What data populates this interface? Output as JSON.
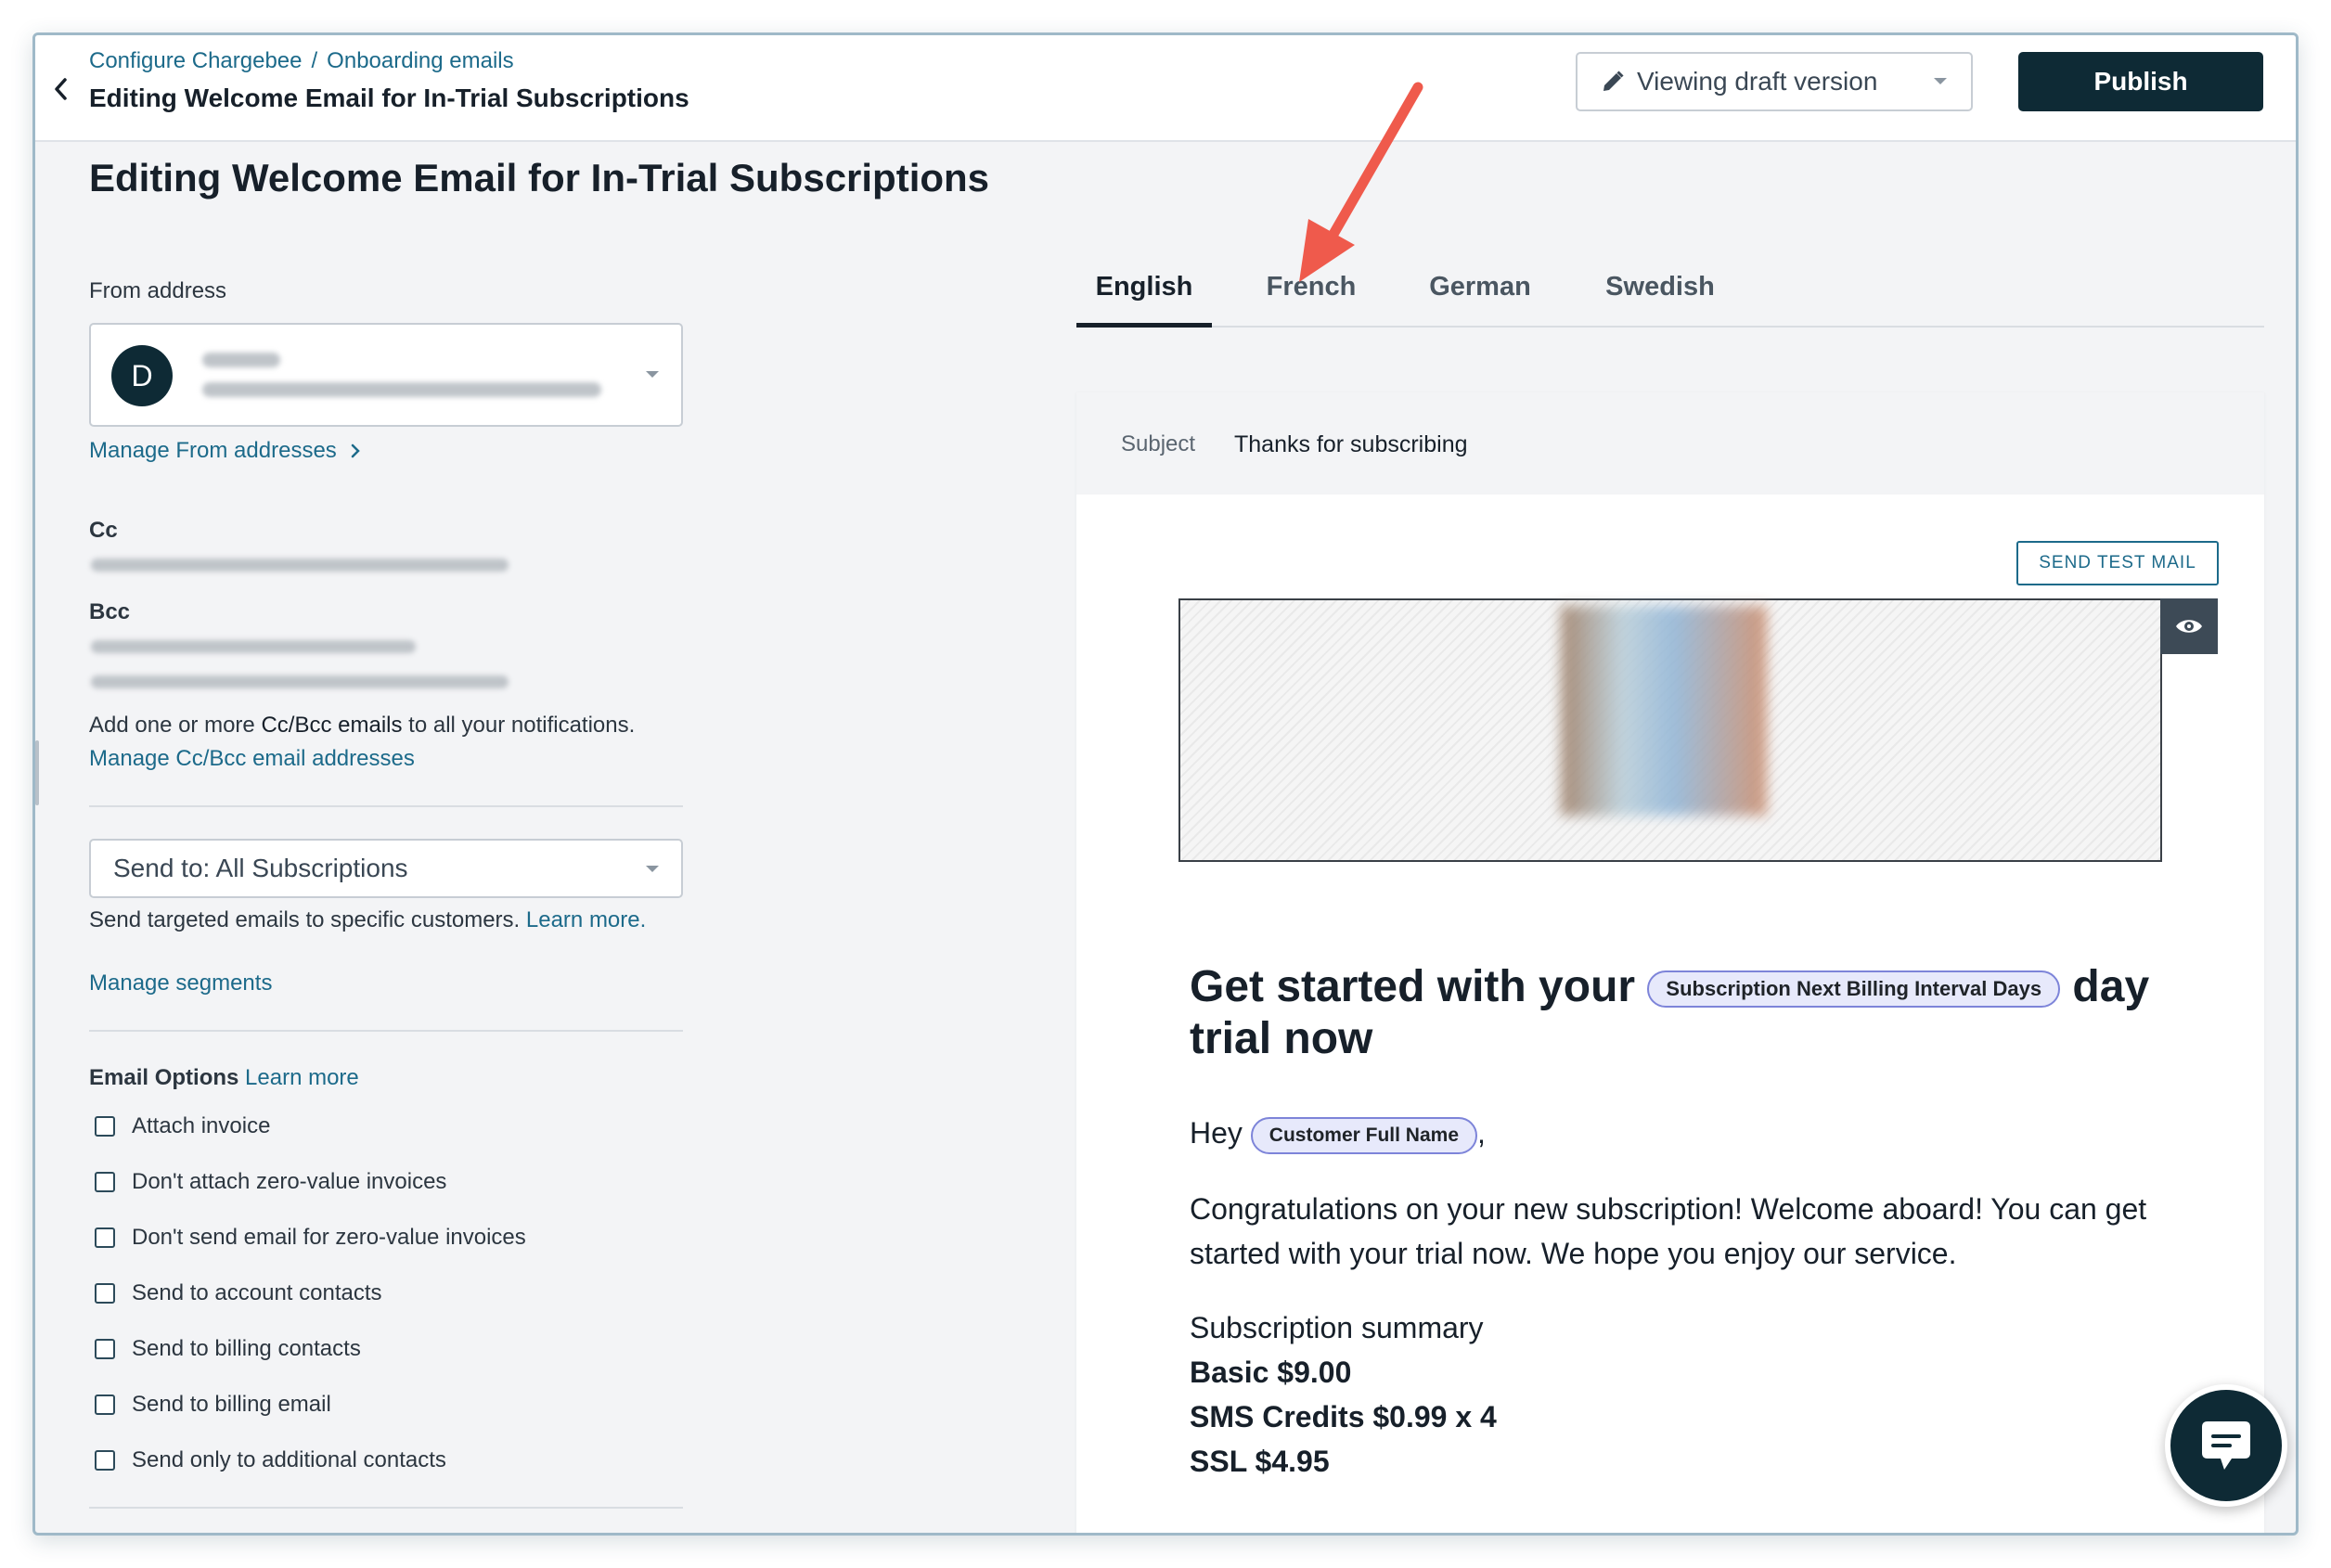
{
  "header": {
    "breadcrumb": [
      "Configure Chargebee",
      "Onboarding emails"
    ],
    "breadcrumb_separator": "/",
    "title": "Editing Welcome Email for In-Trial Subscriptions",
    "version_select": "Viewing draft version",
    "publish_label": "Publish"
  },
  "page": {
    "title": "Editing Welcome Email for In-Trial Subscriptions"
  },
  "left": {
    "from_label": "From address",
    "from_avatar": "D",
    "manage_from_label": "Manage From addresses",
    "cc_label": "Cc",
    "bcc_label": "Bcc",
    "cc_help_prefix": "Add one or more",
    "cc_help_bold": "Cc/Bcc emails",
    "cc_help_suffix": "to all your notifications.",
    "manage_cc_label": "Manage Cc/Bcc email addresses",
    "sendto_value": "Send to: All Subscriptions",
    "sendto_help": "Send targeted emails to specific customers.",
    "sendto_learn": "Learn more.",
    "manage_segments_label": "Manage segments",
    "options_title": "Email Options",
    "options_learn": "Learn more",
    "options": [
      {
        "label": "Attach invoice",
        "checked": false
      },
      {
        "label": "Don't attach zero-value invoices",
        "checked": false
      },
      {
        "label": "Don't send email for zero-value invoices",
        "checked": false
      },
      {
        "label": "Send to account contacts",
        "checked": false
      },
      {
        "label": "Send to billing contacts",
        "checked": false
      },
      {
        "label": "Send to billing email",
        "checked": false
      },
      {
        "label": "Send only to additional contacts",
        "checked": false
      }
    ]
  },
  "tabs": [
    {
      "label": "English",
      "active": true
    },
    {
      "label": "French",
      "active": false
    },
    {
      "label": "German",
      "active": false
    },
    {
      "label": "Swedish",
      "active": false
    }
  ],
  "preview": {
    "subject_label": "Subject",
    "subject_value": "Thanks for subscribing",
    "send_test_label": "SEND TEST MAIL",
    "heading_before": "Get started with your",
    "heading_pill": "Subscription Next Billing Interval Days",
    "heading_after": "day",
    "heading_line2": "trial now",
    "greeting": "Hey",
    "greeting_pill": "Customer Full Name",
    "greeting_suffix": ",",
    "paragraph": "Congratulations on your new subscription! Welcome aboard! You can get started with your trial now. We hope you enjoy our service.",
    "summary_title": "Subscription summary",
    "summary_lines": [
      "Basic $9.00",
      "SMS Credits $0.99 x 4",
      "SSL $4.95"
    ]
  },
  "colors": {
    "brand_dark": "#0e2a35",
    "link": "#1c6a8a",
    "annotation_arrow": "#ef5a4c",
    "pill_bg": "#e7e9fb",
    "pill_border": "#7d84d9"
  },
  "icons": [
    "chevron-left-icon",
    "pencil-icon",
    "chevron-right-icon",
    "eye-icon",
    "chat-icon"
  ]
}
